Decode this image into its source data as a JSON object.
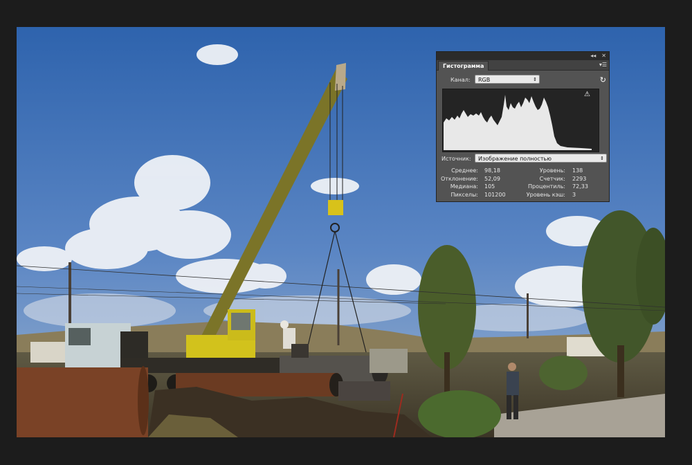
{
  "histogram_panel": {
    "title_controls": {
      "collapse": "◂◂",
      "close": "✕"
    },
    "tab_label": "Гистограмма",
    "menu_icon": "panel-menu-icon",
    "channel_label": "Канал:",
    "channel_value": "RGB",
    "source_label": "Источник:",
    "source_value": "Изображение полностью",
    "stats": {
      "mean_label": "Среднее:",
      "mean_value": "98,18",
      "std_label": "Отклонение:",
      "std_value": "52,09",
      "median_label": "Медиана:",
      "median_value": "105",
      "pixels_label": "Пикселы:",
      "pixels_value": "101200",
      "level_label": "Уровень:",
      "level_value": "138",
      "count_label": "Счетчик:",
      "count_value": "2293",
      "percentile_label": "Процентиль:",
      "percentile_value": "72,33",
      "cache_label": "Уровень кэш:",
      "cache_value": "3"
    },
    "colors": {
      "panel": "#535353",
      "histogram_bg": "#242424",
      "histogram_fill": "#e8e8e8"
    }
  },
  "photo": {
    "subject": "crane-lifting-pipes"
  }
}
